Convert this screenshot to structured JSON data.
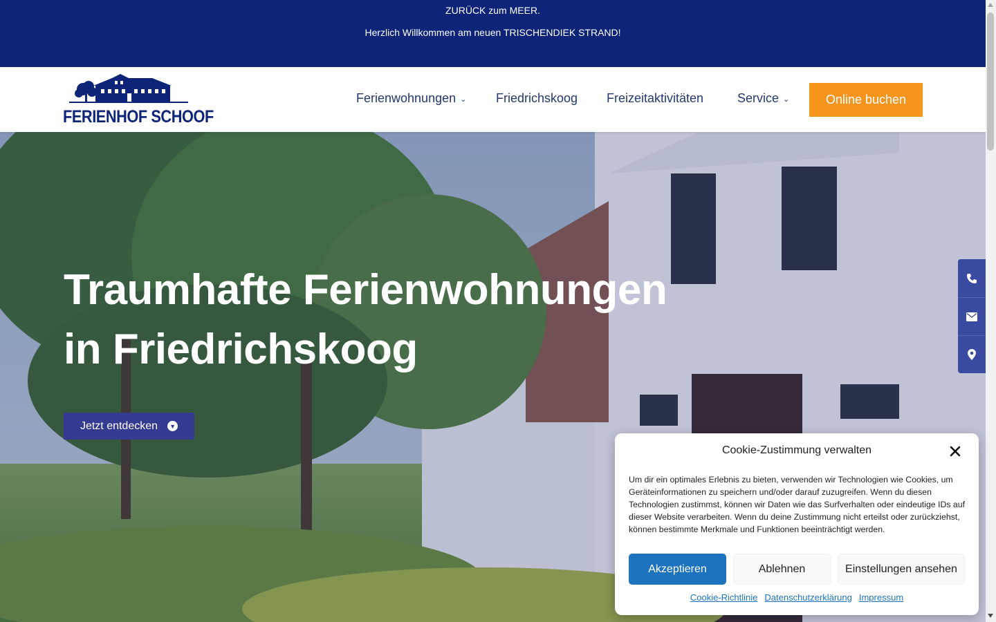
{
  "topbar": {
    "line1": "ZURÜCK zum MEER.",
    "line2": "Herzlich Willkommen am neuen TRISCHENDIEK STRAND!"
  },
  "header": {
    "logo_text": "FERIENHOF SCHOOF",
    "nav": [
      {
        "label": "Ferienwohnungen",
        "has_dropdown": true
      },
      {
        "label": "Friedrichskoog",
        "has_dropdown": false
      },
      {
        "label": "Freizeitaktivitäten",
        "has_dropdown": false
      },
      {
        "label": "Service",
        "has_dropdown": true
      }
    ],
    "book_label": "Online buchen"
  },
  "hero": {
    "title_line1": "Traumhafte Ferienwohnungen",
    "title_line2": "in Friedrichskoog",
    "cta_label": "Jetzt entdecken"
  },
  "side_contact": {
    "icons": [
      "phone-icon",
      "envelope-icon",
      "map-marker-icon"
    ]
  },
  "cookie": {
    "title": "Cookie-Zustimmung verwalten",
    "text": "Um dir ein optimales Erlebnis zu bieten, verwenden wir Technologien wie Cookies, um Geräteinformationen zu speichern und/oder darauf zuzugreifen. Wenn du diesen Technologien zustimmst, können wir Daten wie das Surfverhalten oder eindeutige IDs auf dieser Website verarbeiten. Wenn du deine Zustimmung nicht erteilst oder zurückziehst, können bestimmte Merkmale und Funktionen beeinträchtigt werden.",
    "accept_label": "Akzeptieren",
    "deny_label": "Ablehnen",
    "prefs_label": "Einstellungen ansehen",
    "links": [
      "Cookie-Richtlinie",
      "Datenschutzerklärung",
      "Impressum"
    ]
  },
  "colors": {
    "brand_navy": "#0d2478",
    "accent_orange": "#f7941d",
    "cta_indigo": "#343b91",
    "cookie_blue": "#1e73be"
  }
}
